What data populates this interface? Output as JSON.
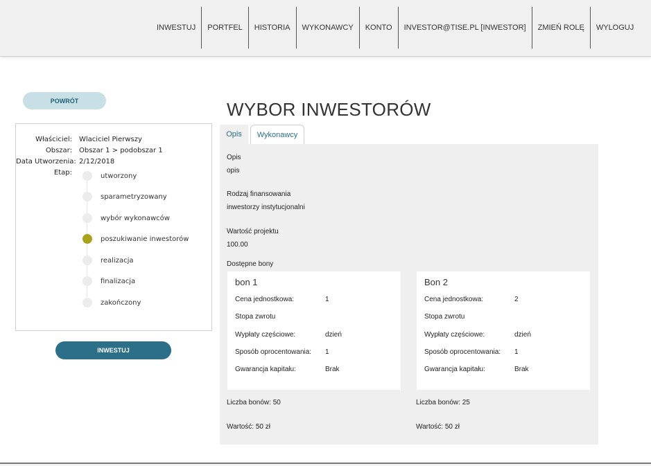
{
  "nav": {
    "items": [
      "INWESTUJ",
      "PORTFEL",
      "HISTORIA",
      "WYKONAWCY",
      "KONTO",
      "INVESTOR@TISE.PL [INWESTOR]",
      "ZMIEŃ ROLĘ",
      "WYLOGUJ"
    ]
  },
  "back_button": "POWRÓT",
  "info": {
    "owner_label": "Właściciel:",
    "owner_value": "Wlaciciel Pierwszy",
    "area_label": "Obszar:",
    "area_value": "Obszar 1 > podobszar 1",
    "date_label": "Data Utworzenia:",
    "date_value": "2/12/2018",
    "stage_label": "Etap:",
    "stages": [
      "utworzony",
      "sparametryzowany",
      "wybór wykonawców",
      "poszukiwanie inwestorów",
      "realizacja",
      "finalizacja",
      "zakończony"
    ],
    "active_stage": "poszukiwanie inwestorów"
  },
  "invest_button": "INWESTUJ",
  "title": "WYBOR INWESTORÓW",
  "tabs": {
    "opis": "Opis",
    "wykonawcy": "Wykonawcy"
  },
  "details": {
    "opis_label": "Opis",
    "opis_value": "opis",
    "financing_label": "Rodzaj finansowania",
    "financing_value": "inwestorzy instytucjonalni",
    "project_value_label": "Wartość projektu",
    "project_value": "100.00",
    "vouchers_label": "Dostępne bony"
  },
  "vouchers": [
    {
      "title": "bon 1",
      "price_label": "Cena jednostkowa:",
      "price": "1",
      "return_label": "Stopa zwrotu",
      "partial_label": "Wypłaty częściowe:",
      "partial": "dzień",
      "interest_label": "Sposób oprocentowania:",
      "interest": "1",
      "guarantee_label": "Gwarancja kapitału:",
      "guarantee": "Brak",
      "count": "Liczba bonów: 50",
      "value": "Wartość: 50 zł"
    },
    {
      "title": "Bon 2",
      "price_label": "Cena jednostkowa:",
      "price": "2",
      "return_label": "Stopa zwrotu",
      "partial_label": "Wypłaty częściowe:",
      "partial": "dzień",
      "interest_label": "Sposób oprocentowania:",
      "interest": "1",
      "guarantee_label": "Gwarancja kapitału:",
      "guarantee": "Brak",
      "count": "Liczba bonów: 25",
      "value": "Wartość: 50 zł"
    }
  ],
  "colors": {
    "accent": "#2b7088",
    "active_stage": "#a8a21d",
    "back_button_bg": "#c9dfe6",
    "panel_bg": "#efefef"
  }
}
